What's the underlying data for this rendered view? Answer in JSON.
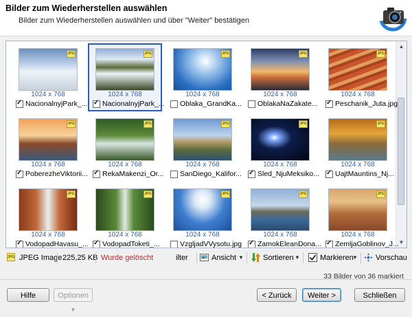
{
  "header": {
    "title": "Bilder zum Wiederherstellen auswählen",
    "subtitle": "Bilder zum Wiederherstellen auswählen und über \"Weiter\" bestätigen"
  },
  "grid_items": [
    {
      "name": "NacionalnyjPark_...",
      "dims": "1024 x 768",
      "checked": true,
      "selected": false,
      "scene": "snow"
    },
    {
      "name": "NacionalnyjPark_...",
      "dims": "1024 x 768",
      "checked": true,
      "selected": true,
      "scene": "falls"
    },
    {
      "name": "Oblaka_GrandKa...",
      "dims": "1024 x 768",
      "checked": false,
      "selected": false,
      "scene": "sky"
    },
    {
      "name": "OblakaNaZakate...",
      "dims": "1024 x 768",
      "checked": false,
      "selected": false,
      "scene": "dusk"
    },
    {
      "name": "Peschanik_Juta.jpg",
      "dims": "1024 x 768",
      "checked": true,
      "selected": false,
      "scene": "sandstone"
    },
    {
      "name": "PoberezheViktorii...",
      "dims": "1024 x 768",
      "checked": true,
      "selected": false,
      "scene": "coast"
    },
    {
      "name": "RekaMakenzi_Or...",
      "dims": "1024 x 768",
      "checked": true,
      "selected": false,
      "scene": "forest"
    },
    {
      "name": "SanDiego_Kalifor...",
      "dims": "1024 x 768",
      "checked": false,
      "selected": false,
      "scene": "cliffs"
    },
    {
      "name": "Sled_NjuMeksiko...",
      "dims": "1024 x 768",
      "checked": true,
      "selected": false,
      "scene": "night"
    },
    {
      "name": "UajtMauntins_Nj...",
      "dims": "1024 x 768",
      "checked": true,
      "selected": false,
      "scene": "autumn"
    },
    {
      "name": "VodopadHavasu_...",
      "dims": "1024 x 768",
      "checked": true,
      "selected": false,
      "scene": "canyon"
    },
    {
      "name": "VodopadToketi_...",
      "dims": "1024 x 768",
      "checked": true,
      "selected": false,
      "scene": "jungle"
    },
    {
      "name": "VzgljadVVysotu.jpg",
      "dims": "1024 x 768",
      "checked": false,
      "selected": false,
      "scene": "clouds"
    },
    {
      "name": "ZamokEleanDona...",
      "dims": "1024 x 768",
      "checked": true,
      "selected": false,
      "scene": "castle"
    },
    {
      "name": "ZemljaGoblinov_J...",
      "dims": "1024 x 768",
      "checked": true,
      "selected": false,
      "scene": "goblin"
    }
  ],
  "icons": {
    "jpg_badge": "JPG",
    "logo": "camera-restore-icon"
  },
  "status_bar": {
    "file_type": "JPEG Image",
    "file_size": "225,25 KB",
    "deleted_label": "Wurde gelöscht",
    "filter_label": "ilter",
    "view_label": "Ansicht",
    "sort_label": "Sortieren",
    "mark_label": "Markieren",
    "preview_label": "Vorschau",
    "deleted_color": "#c0282d"
  },
  "selection_count": "33 Bilder von 36 markiert",
  "buttons": {
    "help": "Hilfe",
    "options": "Optionen",
    "back": "< Zurück",
    "next": "Weiter >",
    "close": "Schließen"
  }
}
